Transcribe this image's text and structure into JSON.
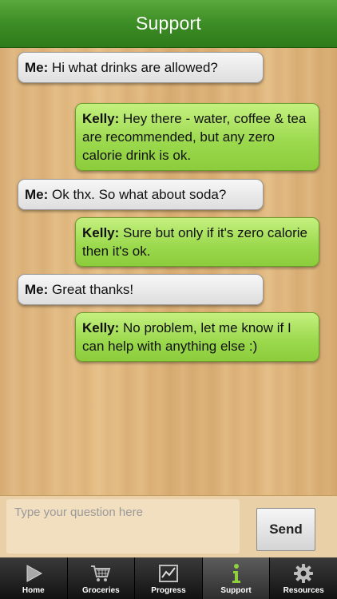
{
  "navbar": {
    "title": "Support"
  },
  "messages": [
    {
      "sender": "Me:",
      "text": " Hi what drinks are allowed?"
    },
    {
      "sender": "Kelly:",
      "text": " Hey there - water, coffee & tea are recommended, but any zero calorie drink is ok."
    },
    {
      "sender": "Me:",
      "text": " Ok thx. So what about soda?"
    },
    {
      "sender": "Kelly:",
      "text": " Sure but only if it's zero calorie then it's ok."
    },
    {
      "sender": "Me:",
      "text": " Great thanks!"
    },
    {
      "sender": "Kelly:",
      "text": " No problem, let me know if I can help with anything else :)"
    }
  ],
  "composer": {
    "placeholder": "Type your question here",
    "value": "",
    "send_label": "Send"
  },
  "tabs": [
    {
      "label": "Home",
      "icon": "play-icon"
    },
    {
      "label": "Groceries",
      "icon": "shopping-cart-icon"
    },
    {
      "label": "Progress",
      "icon": "chart-icon"
    },
    {
      "label": "Support",
      "icon": "info-icon",
      "active": true
    },
    {
      "label": "Resources",
      "icon": "gear-icon"
    }
  ],
  "colors": {
    "navbar": "#3c8d25",
    "kelly_bubble": "#9ad84c",
    "me_bubble": "#e8e8e8"
  }
}
